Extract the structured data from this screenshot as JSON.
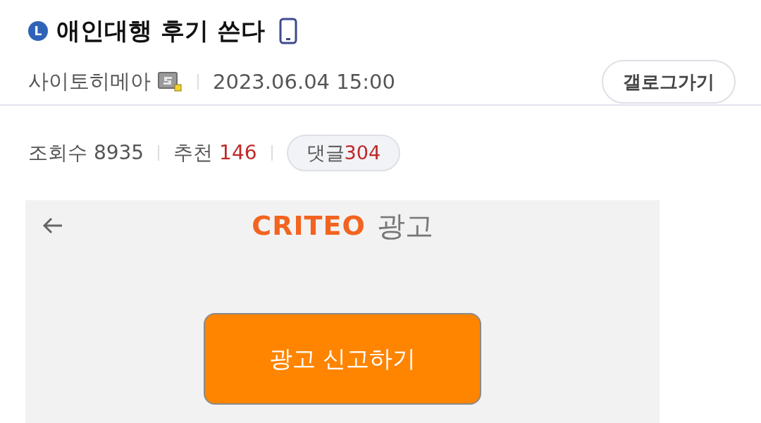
{
  "post": {
    "badge": "L",
    "title": "애인대행 후기 쓴다",
    "author": "사이토히메아",
    "date": "2023.06.04 15:00",
    "gallery_button": "갤로그가기"
  },
  "stats": {
    "views_label": "조회수",
    "views": "8935",
    "recommend_label": "추천",
    "recommend": "146",
    "comments_label": "댓글",
    "comments": "304"
  },
  "ad": {
    "logo": "CRITEO",
    "label": "광고",
    "report_button": "광고 신고하기"
  }
}
